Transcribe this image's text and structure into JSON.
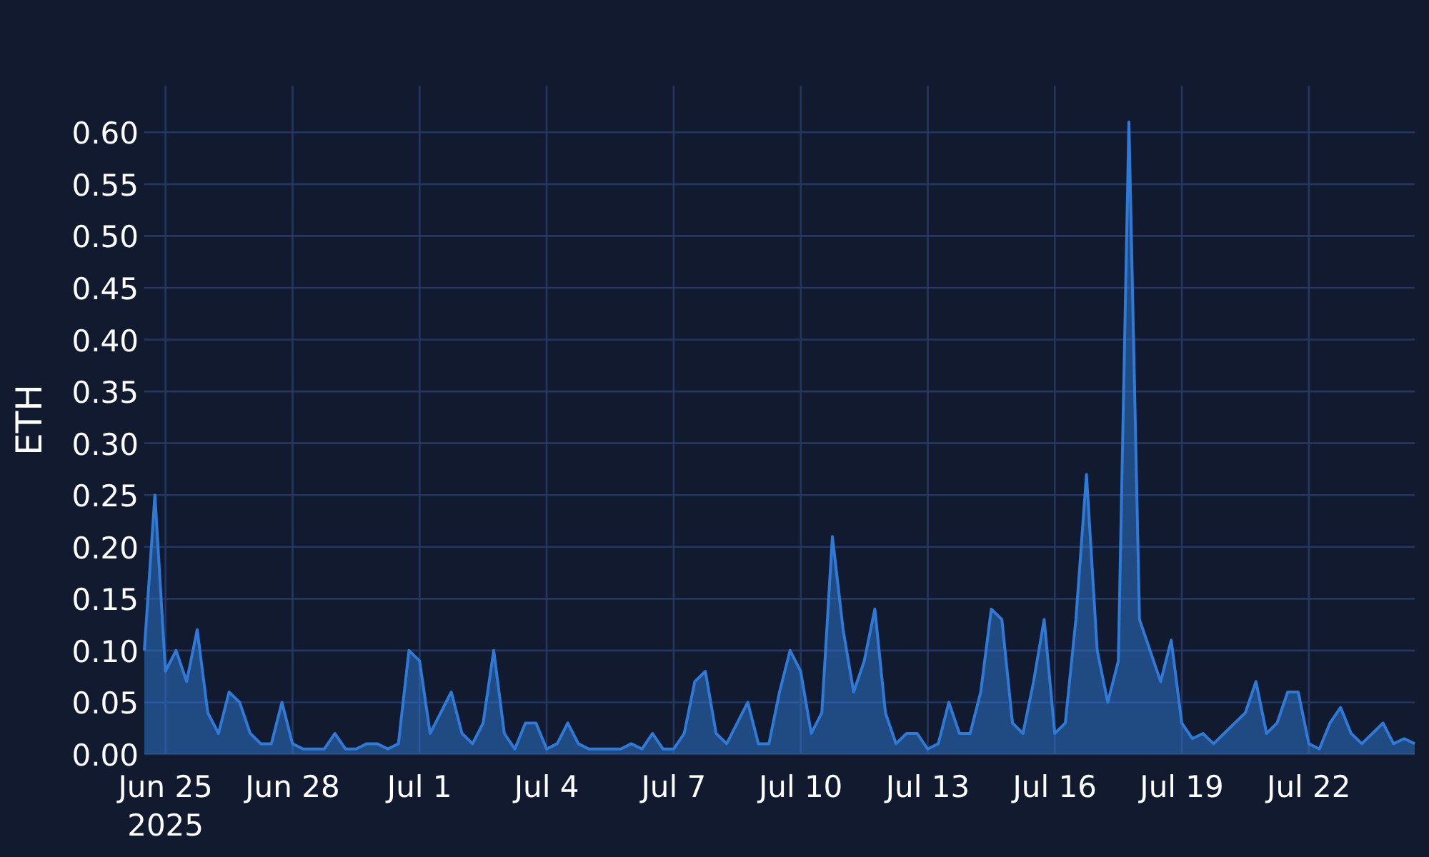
{
  "chart_data": {
    "type": "area",
    "ylabel": "ETH",
    "grid": true,
    "xlim": [
      "2025-06-24 12:00",
      "2025-07-24 12:00"
    ],
    "ylim": [
      0,
      0.645
    ],
    "xticks": [
      {
        "value": "2025-06-25 00:00",
        "label": "Jun 25\n2025"
      },
      {
        "value": "2025-06-28 00:00",
        "label": "Jun 28"
      },
      {
        "value": "2025-07-01 00:00",
        "label": "Jul 1"
      },
      {
        "value": "2025-07-04 00:00",
        "label": "Jul 4"
      },
      {
        "value": "2025-07-07 00:00",
        "label": "Jul 7"
      },
      {
        "value": "2025-07-10 00:00",
        "label": "Jul 10"
      },
      {
        "value": "2025-07-13 00:00",
        "label": "Jul 13"
      },
      {
        "value": "2025-07-16 00:00",
        "label": "Jul 16"
      },
      {
        "value": "2025-07-19 00:00",
        "label": "Jul 19"
      },
      {
        "value": "2025-07-22 00:00",
        "label": "Jul 22"
      }
    ],
    "yticks": [
      {
        "value": 0,
        "label": "0.00"
      },
      {
        "value": 0.05,
        "label": "0.05"
      },
      {
        "value": 0.1,
        "label": "0.10"
      },
      {
        "value": 0.15,
        "label": "0.15"
      },
      {
        "value": 0.2,
        "label": "0.20"
      },
      {
        "value": 0.25,
        "label": "0.25"
      },
      {
        "value": 0.3,
        "label": "0.30"
      },
      {
        "value": 0.35,
        "label": "0.35"
      },
      {
        "value": 0.4,
        "label": "0.40"
      },
      {
        "value": 0.45,
        "label": "0.45"
      },
      {
        "value": 0.5,
        "label": "0.50"
      },
      {
        "value": 0.55,
        "label": "0.55"
      },
      {
        "value": 0.6,
        "label": "0.60"
      }
    ],
    "x": [
      "2025-06-24 12:00",
      "2025-06-24 18:00",
      "2025-06-25 00:00",
      "2025-06-25 06:00",
      "2025-06-25 12:00",
      "2025-06-25 18:00",
      "2025-06-26 00:00",
      "2025-06-26 06:00",
      "2025-06-26 12:00",
      "2025-06-26 18:00",
      "2025-06-27 00:00",
      "2025-06-27 06:00",
      "2025-06-27 12:00",
      "2025-06-27 18:00",
      "2025-06-28 00:00",
      "2025-06-28 06:00",
      "2025-06-28 12:00",
      "2025-06-28 18:00",
      "2025-06-29 00:00",
      "2025-06-29 06:00",
      "2025-06-29 12:00",
      "2025-06-29 18:00",
      "2025-06-30 00:00",
      "2025-06-30 06:00",
      "2025-06-30 12:00",
      "2025-06-30 18:00",
      "2025-07-01 00:00",
      "2025-07-01 06:00",
      "2025-07-01 12:00",
      "2025-07-01 18:00",
      "2025-07-02 00:00",
      "2025-07-02 06:00",
      "2025-07-02 12:00",
      "2025-07-02 18:00",
      "2025-07-03 00:00",
      "2025-07-03 06:00",
      "2025-07-03 12:00",
      "2025-07-03 18:00",
      "2025-07-04 00:00",
      "2025-07-04 06:00",
      "2025-07-04 12:00",
      "2025-07-04 18:00",
      "2025-07-05 00:00",
      "2025-07-05 06:00",
      "2025-07-05 12:00",
      "2025-07-05 18:00",
      "2025-07-06 00:00",
      "2025-07-06 06:00",
      "2025-07-06 12:00",
      "2025-07-06 18:00",
      "2025-07-07 00:00",
      "2025-07-07 06:00",
      "2025-07-07 12:00",
      "2025-07-07 18:00",
      "2025-07-08 00:00",
      "2025-07-08 06:00",
      "2025-07-08 12:00",
      "2025-07-08 18:00",
      "2025-07-09 00:00",
      "2025-07-09 06:00",
      "2025-07-09 12:00",
      "2025-07-09 18:00",
      "2025-07-10 00:00",
      "2025-07-10 06:00",
      "2025-07-10 12:00",
      "2025-07-10 18:00",
      "2025-07-11 00:00",
      "2025-07-11 06:00",
      "2025-07-11 12:00",
      "2025-07-11 18:00",
      "2025-07-12 00:00",
      "2025-07-12 06:00",
      "2025-07-12 12:00",
      "2025-07-12 18:00",
      "2025-07-13 00:00",
      "2025-07-13 06:00",
      "2025-07-13 12:00",
      "2025-07-13 18:00",
      "2025-07-14 00:00",
      "2025-07-14 06:00",
      "2025-07-14 12:00",
      "2025-07-14 18:00",
      "2025-07-15 00:00",
      "2025-07-15 06:00",
      "2025-07-15 12:00",
      "2025-07-15 18:00",
      "2025-07-16 00:00",
      "2025-07-16 06:00",
      "2025-07-16 12:00",
      "2025-07-16 18:00",
      "2025-07-17 00:00",
      "2025-07-17 06:00",
      "2025-07-17 12:00",
      "2025-07-17 18:00",
      "2025-07-18 00:00",
      "2025-07-18 06:00",
      "2025-07-18 12:00",
      "2025-07-18 18:00",
      "2025-07-19 00:00",
      "2025-07-19 06:00",
      "2025-07-19 12:00",
      "2025-07-19 18:00",
      "2025-07-20 00:00",
      "2025-07-20 06:00",
      "2025-07-20 12:00",
      "2025-07-20 18:00",
      "2025-07-21 00:00",
      "2025-07-21 06:00",
      "2025-07-21 12:00",
      "2025-07-21 18:00",
      "2025-07-22 00:00",
      "2025-07-22 06:00",
      "2025-07-22 12:00",
      "2025-07-22 18:00",
      "2025-07-23 00:00",
      "2025-07-23 06:00",
      "2025-07-23 12:00",
      "2025-07-23 18:00",
      "2025-07-24 00:00",
      "2025-07-24 06:00",
      "2025-07-24 12:00"
    ],
    "series": [
      {
        "color": "#2f7ad6",
        "values": [
          0.1,
          0.25,
          0.08,
          0.1,
          0.07,
          0.12,
          0.04,
          0.02,
          0.06,
          0.05,
          0.02,
          0.01,
          0.01,
          0.05,
          0.01,
          0.005,
          0.005,
          0.005,
          0.02,
          0.005,
          0.005,
          0.01,
          0.01,
          0.005,
          0.01,
          0.1,
          0.09,
          0.02,
          0.04,
          0.06,
          0.02,
          0.01,
          0.03,
          0.1,
          0.02,
          0.005,
          0.03,
          0.03,
          0.005,
          0.01,
          0.03,
          0.01,
          0.005,
          0.005,
          0.005,
          0.005,
          0.01,
          0.005,
          0.02,
          0.005,
          0.005,
          0.02,
          0.07,
          0.08,
          0.02,
          0.01,
          0.03,
          0.05,
          0.01,
          0.01,
          0.06,
          0.1,
          0.08,
          0.02,
          0.04,
          0.21,
          0.12,
          0.06,
          0.09,
          0.14,
          0.04,
          0.01,
          0.02,
          0.02,
          0.005,
          0.01,
          0.05,
          0.02,
          0.02,
          0.06,
          0.14,
          0.13,
          0.03,
          0.02,
          0.07,
          0.13,
          0.02,
          0.03,
          0.13,
          0.27,
          0.1,
          0.05,
          0.09,
          0.61,
          0.13,
          0.1,
          0.07,
          0.11,
          0.03,
          0.015,
          0.02,
          0.01,
          0.02,
          0.03,
          0.04,
          0.07,
          0.02,
          0.03,
          0.06,
          0.06,
          0.01,
          0.005,
          0.03,
          0.045,
          0.02,
          0.01,
          0.02,
          0.03,
          0.01,
          0.015,
          0.01
        ]
      }
    ]
  }
}
